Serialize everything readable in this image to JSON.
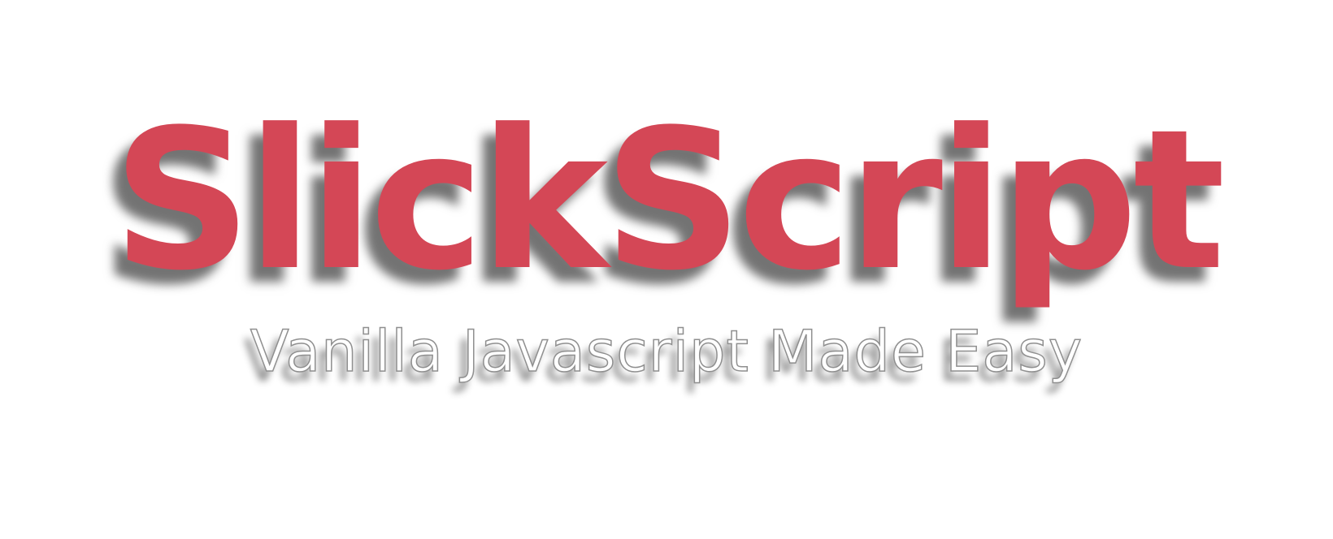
{
  "logo": {
    "title": "SlickScript",
    "tagline": "Vanilla Javascript Made Easy"
  },
  "colors": {
    "background": "#ffffff",
    "title": "#d44756",
    "tagline_fill": "#ffffff",
    "tagline_outline": "#8f8f8f",
    "shadow": "#000000"
  }
}
